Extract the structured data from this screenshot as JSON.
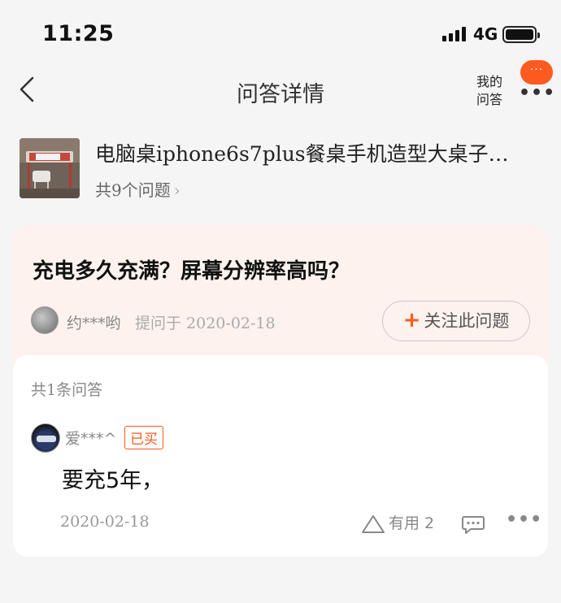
{
  "status_bar": {
    "time": "11:25",
    "network": "4G"
  },
  "nav": {
    "title": "问答详情",
    "my_qa_line1": "我的",
    "my_qa_line2": "问答",
    "badge": "···",
    "more": "•••"
  },
  "product": {
    "title": "电脑桌iphone6s7plus餐桌手机造型大桌子…",
    "question_count": "共9个问题",
    "chevron": "›"
  },
  "question": {
    "title": "充电多久充满？屏幕分辨率高吗？",
    "asker": "约***哟",
    "asked_at": "提问于 2020-02-18",
    "follow_plus": "+",
    "follow_label": "关注此问题"
  },
  "answers": {
    "count_label": "共1条问答",
    "items": [
      {
        "author": "爱***^",
        "badge": "已买",
        "text": "要充5年，",
        "date": "2020-02-18",
        "useful_label": "有用 2",
        "more": "•••"
      }
    ]
  },
  "colors": {
    "accent": "#ff5a1f",
    "question_card_bg": "#fdf2ee",
    "page_bg": "#f5f5f5"
  }
}
